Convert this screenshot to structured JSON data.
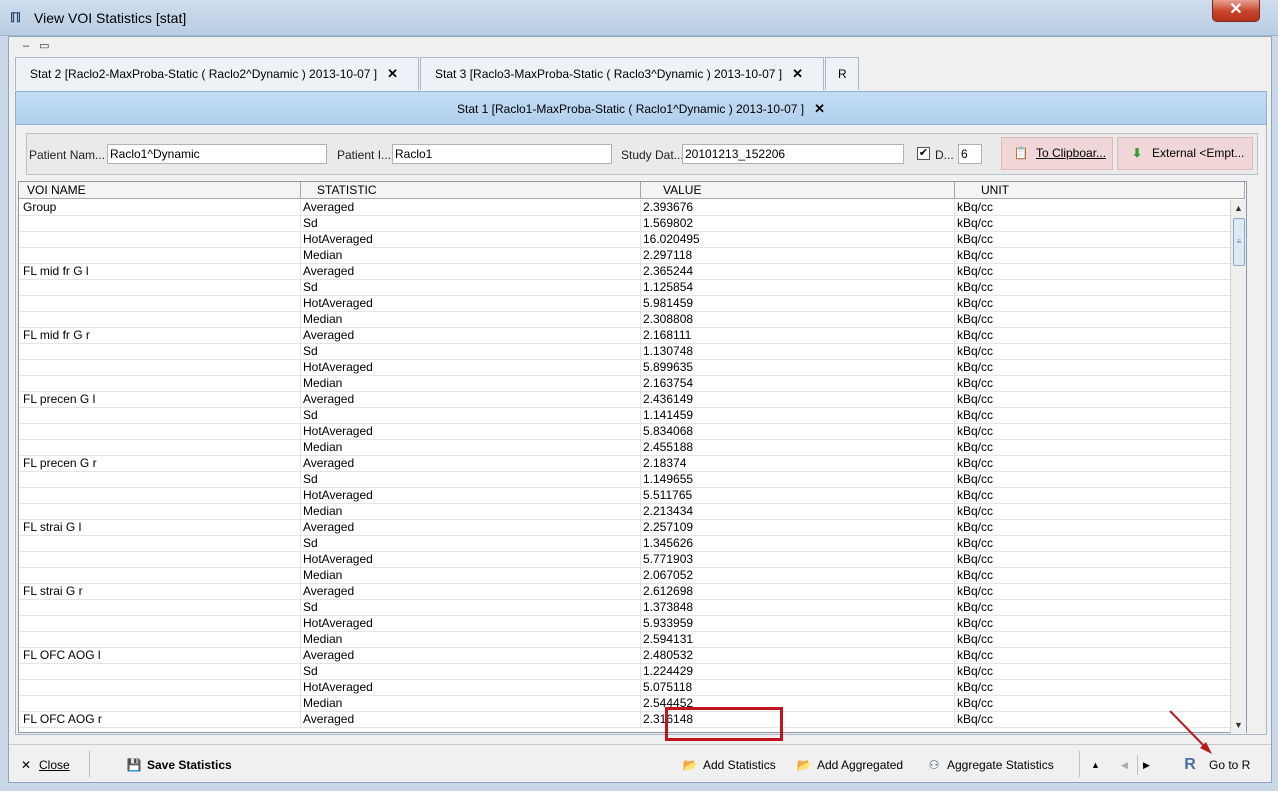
{
  "window": {
    "title": "View VOI Statistics [stat]",
    "close_glyph": "✕"
  },
  "tabs": [
    {
      "label": "Stat 2 [Raclo2-MaxProba-Static ( Raclo2^Dynamic ) 2013-10-07 ]"
    },
    {
      "label": "Stat 3 [Raclo3-MaxProba-Static ( Raclo3^Dynamic ) 2013-10-07 ]"
    },
    {
      "label": "R"
    }
  ],
  "active_tab": {
    "label": "Stat 1 [Raclo1-MaxProba-Static ( Raclo1^Dynamic ) 2013-10-07 ]"
  },
  "info": {
    "patient_name_label": "Patient Nam...",
    "patient_name": "Raclo1^Dynamic",
    "patient_id_label": "Patient I...",
    "patient_id": "Raclo1",
    "study_date_label": "Study Dat...",
    "study_date": "20101213_152206",
    "decimals_label": "D...",
    "decimals_checked": true,
    "decimals": "6",
    "clipboard_label": "To Clipboar...",
    "external_label": "External <Empt..."
  },
  "table": {
    "columns": [
      "VOI NAME",
      "STATISTIC",
      "VALUE",
      "UNIT"
    ],
    "rows": [
      [
        "Group",
        "Averaged",
        "2.393676",
        "kBq/cc"
      ],
      [
        "",
        "Sd",
        "1.569802",
        "kBq/cc"
      ],
      [
        "",
        "HotAveraged",
        "16.020495",
        "kBq/cc"
      ],
      [
        "",
        "Median",
        "2.297118",
        "kBq/cc"
      ],
      [
        "FL mid fr G l",
        "Averaged",
        "2.365244",
        "kBq/cc"
      ],
      [
        "",
        "Sd",
        "1.125854",
        "kBq/cc"
      ],
      [
        "",
        "HotAveraged",
        "5.981459",
        "kBq/cc"
      ],
      [
        "",
        "Median",
        "2.308808",
        "kBq/cc"
      ],
      [
        "FL mid fr G r",
        "Averaged",
        "2.168111",
        "kBq/cc"
      ],
      [
        "",
        "Sd",
        "1.130748",
        "kBq/cc"
      ],
      [
        "",
        "HotAveraged",
        "5.899635",
        "kBq/cc"
      ],
      [
        "",
        "Median",
        "2.163754",
        "kBq/cc"
      ],
      [
        "FL precen G l",
        "Averaged",
        "2.436149",
        "kBq/cc"
      ],
      [
        "",
        "Sd",
        "1.141459",
        "kBq/cc"
      ],
      [
        "",
        "HotAveraged",
        "5.834068",
        "kBq/cc"
      ],
      [
        "",
        "Median",
        "2.455188",
        "kBq/cc"
      ],
      [
        "FL precen G r",
        "Averaged",
        "2.18374",
        "kBq/cc"
      ],
      [
        "",
        "Sd",
        "1.149655",
        "kBq/cc"
      ],
      [
        "",
        "HotAveraged",
        "5.511765",
        "kBq/cc"
      ],
      [
        "",
        "Median",
        "2.213434",
        "kBq/cc"
      ],
      [
        "FL strai G l",
        "Averaged",
        "2.257109",
        "kBq/cc"
      ],
      [
        "",
        "Sd",
        "1.345626",
        "kBq/cc"
      ],
      [
        "",
        "HotAveraged",
        "5.771903",
        "kBq/cc"
      ],
      [
        "",
        "Median",
        "2.067052",
        "kBq/cc"
      ],
      [
        "FL strai G r",
        "Averaged",
        "2.612698",
        "kBq/cc"
      ],
      [
        "",
        "Sd",
        "1.373848",
        "kBq/cc"
      ],
      [
        "",
        "HotAveraged",
        "5.933959",
        "kBq/cc"
      ],
      [
        "",
        "Median",
        "2.594131",
        "kBq/cc"
      ],
      [
        "FL OFC AOG l",
        "Averaged",
        "2.480532",
        "kBq/cc"
      ],
      [
        "",
        "Sd",
        "1.224429",
        "kBq/cc"
      ],
      [
        "",
        "HotAveraged",
        "5.075118",
        "kBq/cc"
      ],
      [
        "",
        "Median",
        "2.544452",
        "kBq/cc"
      ],
      [
        "FL OFC AOG r",
        "Averaged",
        "2.316148",
        "kBq/cc"
      ]
    ]
  },
  "bottom": {
    "close_label": "Close",
    "save_label": "Save Statistics",
    "add_statistics_label": "Add Statistics",
    "add_aggregated_label": "Add Aggregated",
    "aggregate_label": "Aggregate Statistics",
    "go_to_r_label": "Go to R"
  },
  "colors": {
    "highlight": "#c0151f",
    "arrow": "#b71c1c",
    "active_tab": "#b8d4ef"
  }
}
